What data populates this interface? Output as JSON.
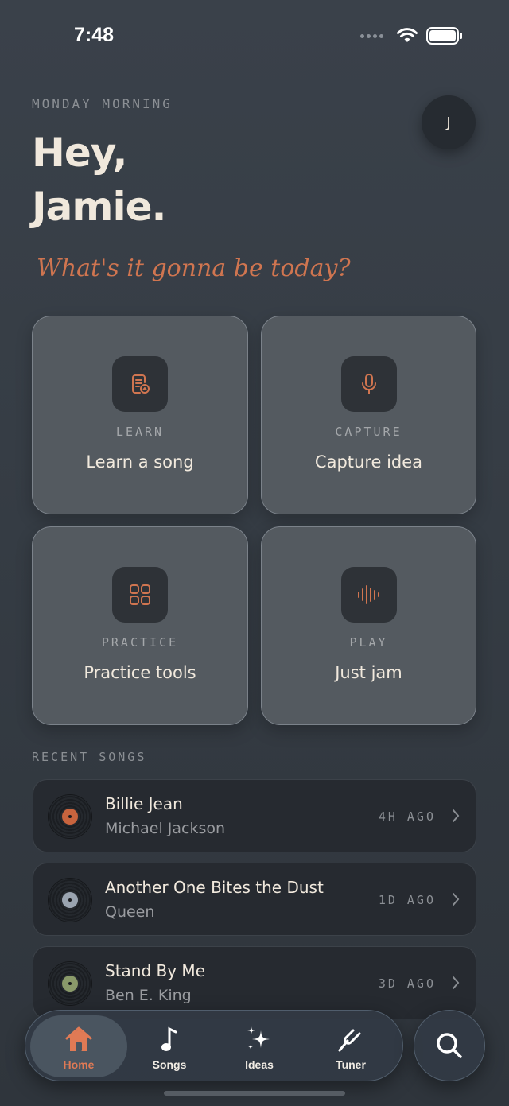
{
  "status": {
    "time": "7:48"
  },
  "header": {
    "greeting_label": "MONDAY MORNING",
    "greeting_line1": "Hey,",
    "greeting_line2": "Jamie.",
    "tagline": "What's it gonna be today?",
    "avatar_initial": "J"
  },
  "tiles": [
    {
      "kicker": "LEARN",
      "title": "Learn a song",
      "icon": "song-sheet-icon"
    },
    {
      "kicker": "CAPTURE",
      "title": "Capture idea",
      "icon": "microphone-icon"
    },
    {
      "kicker": "PRACTICE",
      "title": "Practice tools",
      "icon": "grid-icon"
    },
    {
      "kicker": "PLAY",
      "title": "Just jam",
      "icon": "waveform-icon"
    }
  ],
  "recent": {
    "label": "RECENT SONGS",
    "songs": [
      {
        "title": "Billie Jean",
        "artist": "Michael Jackson",
        "time": "4H AGO",
        "label_color": "#c8643e"
      },
      {
        "title": "Another One Bites the Dust",
        "artist": "Queen",
        "time": "1D AGO",
        "label_color": "#9aa4b0"
      },
      {
        "title": "Stand By Me",
        "artist": "Ben E. King",
        "time": "3D AGO",
        "label_color": "#8a9a6a"
      }
    ]
  },
  "tabbar": {
    "tabs": [
      {
        "label": "Home",
        "icon": "home-icon",
        "active": true
      },
      {
        "label": "Songs",
        "icon": "music-note-icon",
        "active": false
      },
      {
        "label": "Ideas",
        "icon": "sparkles-icon",
        "active": false
      },
      {
        "label": "Tuner",
        "icon": "tuning-fork-icon",
        "active": false
      }
    ],
    "search_icon": "search-icon"
  },
  "colors": {
    "accent": "#d07550",
    "background": "#363d45",
    "tile": "#545a60",
    "card": "#262a30"
  }
}
